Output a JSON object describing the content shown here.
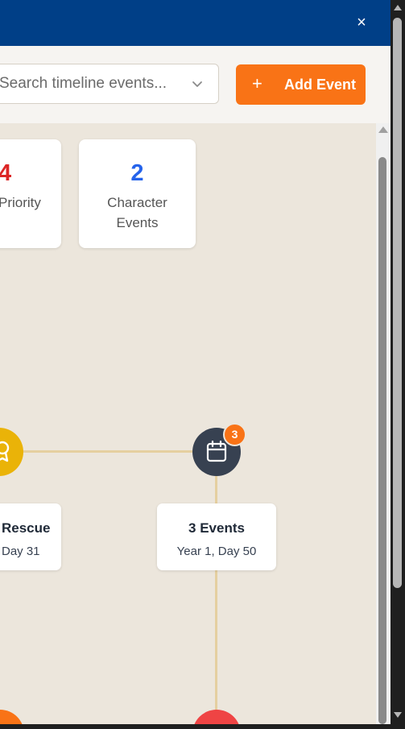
{
  "titlebar": {
    "close_glyph": "×"
  },
  "toolbar": {
    "search_placeholder": "Search timeline events...",
    "add_button": {
      "icon": "+",
      "label": "Add Event"
    }
  },
  "stats": [
    {
      "value": "4",
      "label": "Priority",
      "color": "#dc2626"
    },
    {
      "value": "2",
      "label_line1": "Character",
      "label_line2": "Events",
      "color": "#2563eb"
    }
  ],
  "nodes": {
    "left": {
      "icon": "award-icon",
      "color": "#eab308"
    },
    "center": {
      "icon": "calendar-icon",
      "color": "#374151",
      "badge": "3"
    },
    "bottom_left": {
      "color": "#f97316"
    },
    "bottom_center": {
      "color": "#ef4444"
    }
  },
  "events": [
    {
      "title": "Rescue",
      "date": "Day 31"
    },
    {
      "title": "3 Events",
      "date": "Year 1, Day 50"
    }
  ],
  "colors": {
    "connector": "#e5cfa0",
    "accent": "#f97316",
    "header": "#003f87"
  }
}
